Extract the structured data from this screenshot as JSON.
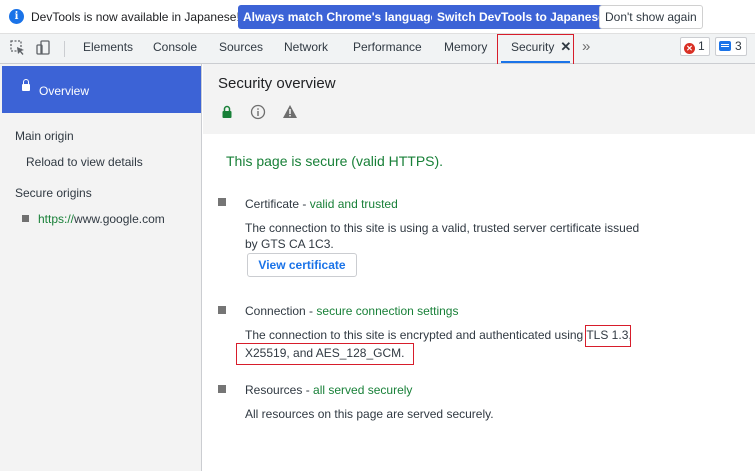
{
  "infobar": {
    "message": "DevTools is now available in Japanese!",
    "btn_match": "Always match Chrome's language",
    "btn_switch": "Switch DevTools to Japanese",
    "btn_dismiss": "Don't show again"
  },
  "tabs": {
    "elements": "Elements",
    "console": "Console",
    "sources": "Sources",
    "network": "Network",
    "performance": "Performance",
    "memory": "Memory",
    "security": "Security",
    "close_glyph": "✕",
    "more_glyph": "»"
  },
  "badges": {
    "errors": "1",
    "messages": "3"
  },
  "sidebar": {
    "overview": "Overview",
    "main_origin": "Main origin",
    "reload": "Reload to view details",
    "secure_origins": "Secure origins",
    "origin_scheme": "https://",
    "origin_host": "www.google.com"
  },
  "main": {
    "title": "Security overview",
    "summary": "This page is secure (valid HTTPS).",
    "certificate": {
      "label": "Certificate",
      "status": "valid and trusted",
      "body_line1": "The connection to this site is using a valid, trusted server certificate issued",
      "body_line2": "by GTS CA 1C3.",
      "button": "View certificate"
    },
    "connection": {
      "label": "Connection",
      "status": "secure connection settings",
      "body_part1": "The connection to this site is encrypted and authenticated using ",
      "body_tls": "TLS 1.3,",
      "body_part2": "X25519, and AES_128_GCM."
    },
    "resources": {
      "label": "Resources",
      "status": "all served securely",
      "body": "All resources on this page are served securely."
    }
  },
  "colors": {
    "accent": "#3c63d6",
    "secure_green": "#188038",
    "highlight_red": "#d71d2b",
    "link_blue": "#1a73e8"
  }
}
